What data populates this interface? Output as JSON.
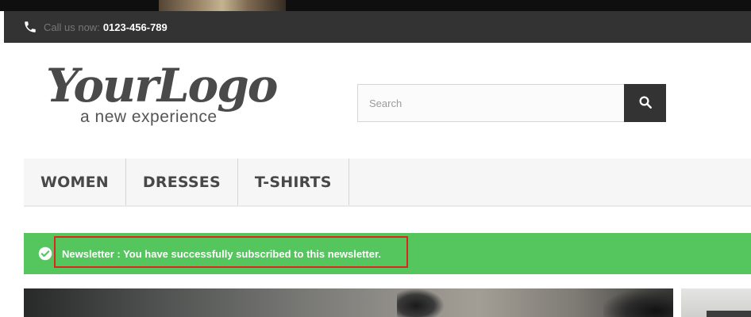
{
  "header": {
    "phone_label": "Call us now:",
    "phone_number": "0123-456-789",
    "phone_icon": "phone-icon"
  },
  "logo": {
    "script_text": "YourLogo",
    "tagline": "a new experience"
  },
  "search": {
    "placeholder": "Search",
    "value": "",
    "button_icon": "search-icon"
  },
  "menu": {
    "items": [
      {
        "label": "WOMEN"
      },
      {
        "label": "DRESSES"
      },
      {
        "label": "T-SHIRTS"
      }
    ]
  },
  "alert": {
    "icon": "check-circle-icon",
    "message": "Newsletter : You have successfully subscribed to this newsletter.",
    "color": "#55c65e",
    "highlight_color": "#d9271d"
  },
  "colors": {
    "header_bg": "#333333",
    "menu_bg": "#f6f6f6",
    "search_button_bg": "#333333"
  }
}
